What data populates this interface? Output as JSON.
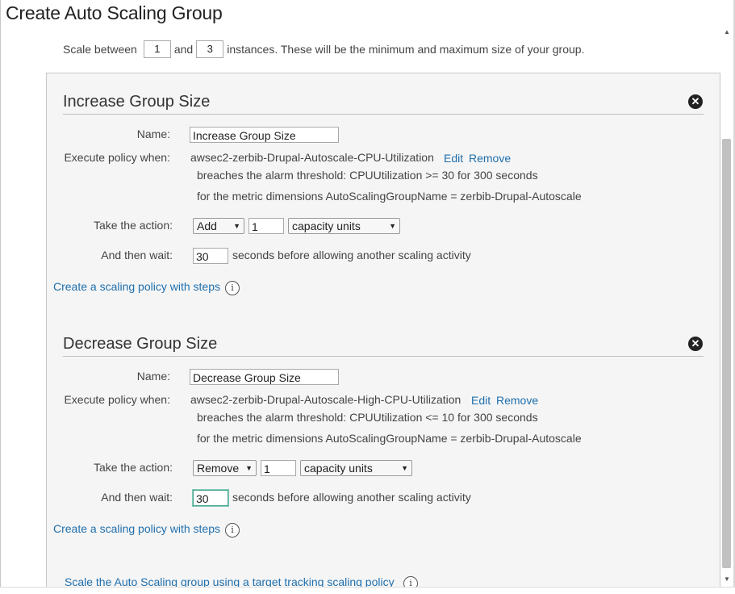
{
  "page": {
    "title": "Create Auto Scaling Group"
  },
  "scale": {
    "prefix": "Scale between",
    "min": "1",
    "and": "and",
    "max": "3",
    "suffix": "instances. These will be the minimum and maximum size of your group."
  },
  "increase": {
    "title": "Increase Group Size",
    "name_label": "Name:",
    "name_value": "Increase Group Size",
    "execute_label": "Execute policy when:",
    "alarm": "awsec2-zerbib-Drupal-Autoscale-CPU-Utilization",
    "edit": "Edit",
    "remove": "Remove",
    "breaches": "breaches the alarm threshold: CPUUtilization >= 30 for 300 seconds",
    "dimensions": "for the metric dimensions  AutoScalingGroupName = zerbib-Drupal-Autoscale",
    "action_label": "Take the action:",
    "action": "Add",
    "amount": "1",
    "units": "capacity units",
    "wait_label": "And then wait:",
    "wait": "30",
    "wait_suffix": "seconds before allowing another scaling activity",
    "steps_link": "Create a scaling policy with steps"
  },
  "decrease": {
    "title": "Decrease Group Size",
    "name_label": "Name:",
    "name_value": "Decrease Group Size",
    "execute_label": "Execute policy when:",
    "alarm": "awsec2-zerbib-Drupal-Autoscale-High-CPU-Utilization",
    "edit": "Edit",
    "remove": "Remove",
    "breaches": "breaches the alarm threshold: CPUUtilization <= 10 for 300 seconds",
    "dimensions": "for the metric dimensions  AutoScalingGroupName = zerbib-Drupal-Autoscale",
    "action_label": "Take the action:",
    "action": "Remove",
    "amount": "1",
    "units": "capacity units",
    "wait_label": "And then wait:",
    "wait": "30",
    "wait_suffix": "seconds before allowing another scaling activity",
    "steps_link": "Create a scaling policy with steps"
  },
  "target_tracking_link": "Scale the Auto Scaling group using a target tracking scaling policy",
  "icons": {
    "close": "✕",
    "info": "i",
    "arrow": "▼",
    "scroll_up": "▲",
    "scroll_down": "▼"
  },
  "colors": {
    "link": "#1f6fad",
    "panel_bg": "#f5f5f5",
    "focus": "#4aa58e"
  }
}
